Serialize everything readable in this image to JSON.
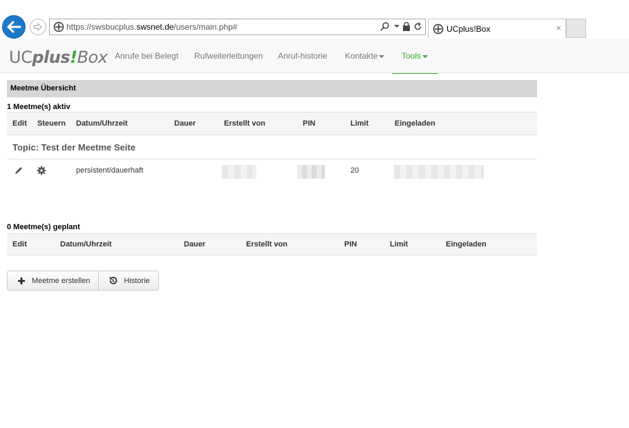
{
  "browser": {
    "url_prefix": "https://swsbucplus.",
    "url_host": "swsnet.de",
    "url_path": "/users/main.php#",
    "tab_title": "UCplus!Box",
    "tab_close": "×"
  },
  "brand": {
    "part1": "UC",
    "part2": "plus",
    "part3": "!",
    "part4": "Box"
  },
  "nav": {
    "items": [
      {
        "label": "Anrufe bei Belegt"
      },
      {
        "label": "Rufweiterleitungen"
      },
      {
        "label": "Anruf-historie"
      },
      {
        "label": "Kontakte"
      },
      {
        "label": "Tools"
      }
    ]
  },
  "overview": {
    "title": "Meetme Übersicht",
    "active_count": "1 Meetme(s) aktiv",
    "active_columns": [
      "Edit",
      "Steuern",
      "Datum/Uhrzeit",
      "Dauer",
      "Erstellt von",
      "PIN",
      "Limit",
      "Eingeladen"
    ],
    "topic": "Topic: Test der Meetme Seite",
    "active_rows": [
      {
        "datetime": "persistent/dauerhaft",
        "limit": "20"
      }
    ],
    "planned_count": "0 Meetme(s) geplant",
    "planned_columns": [
      "Edit",
      "Datum/Uhrzeit",
      "Dauer",
      "Erstellt von",
      "PIN",
      "Limit",
      "Eingeladen"
    ]
  },
  "buttons": {
    "create_label": "Meetme erstellen",
    "history_label": "Historie"
  },
  "colors": {
    "accent": "#3aaa35",
    "back_button": "#1e78c8"
  }
}
